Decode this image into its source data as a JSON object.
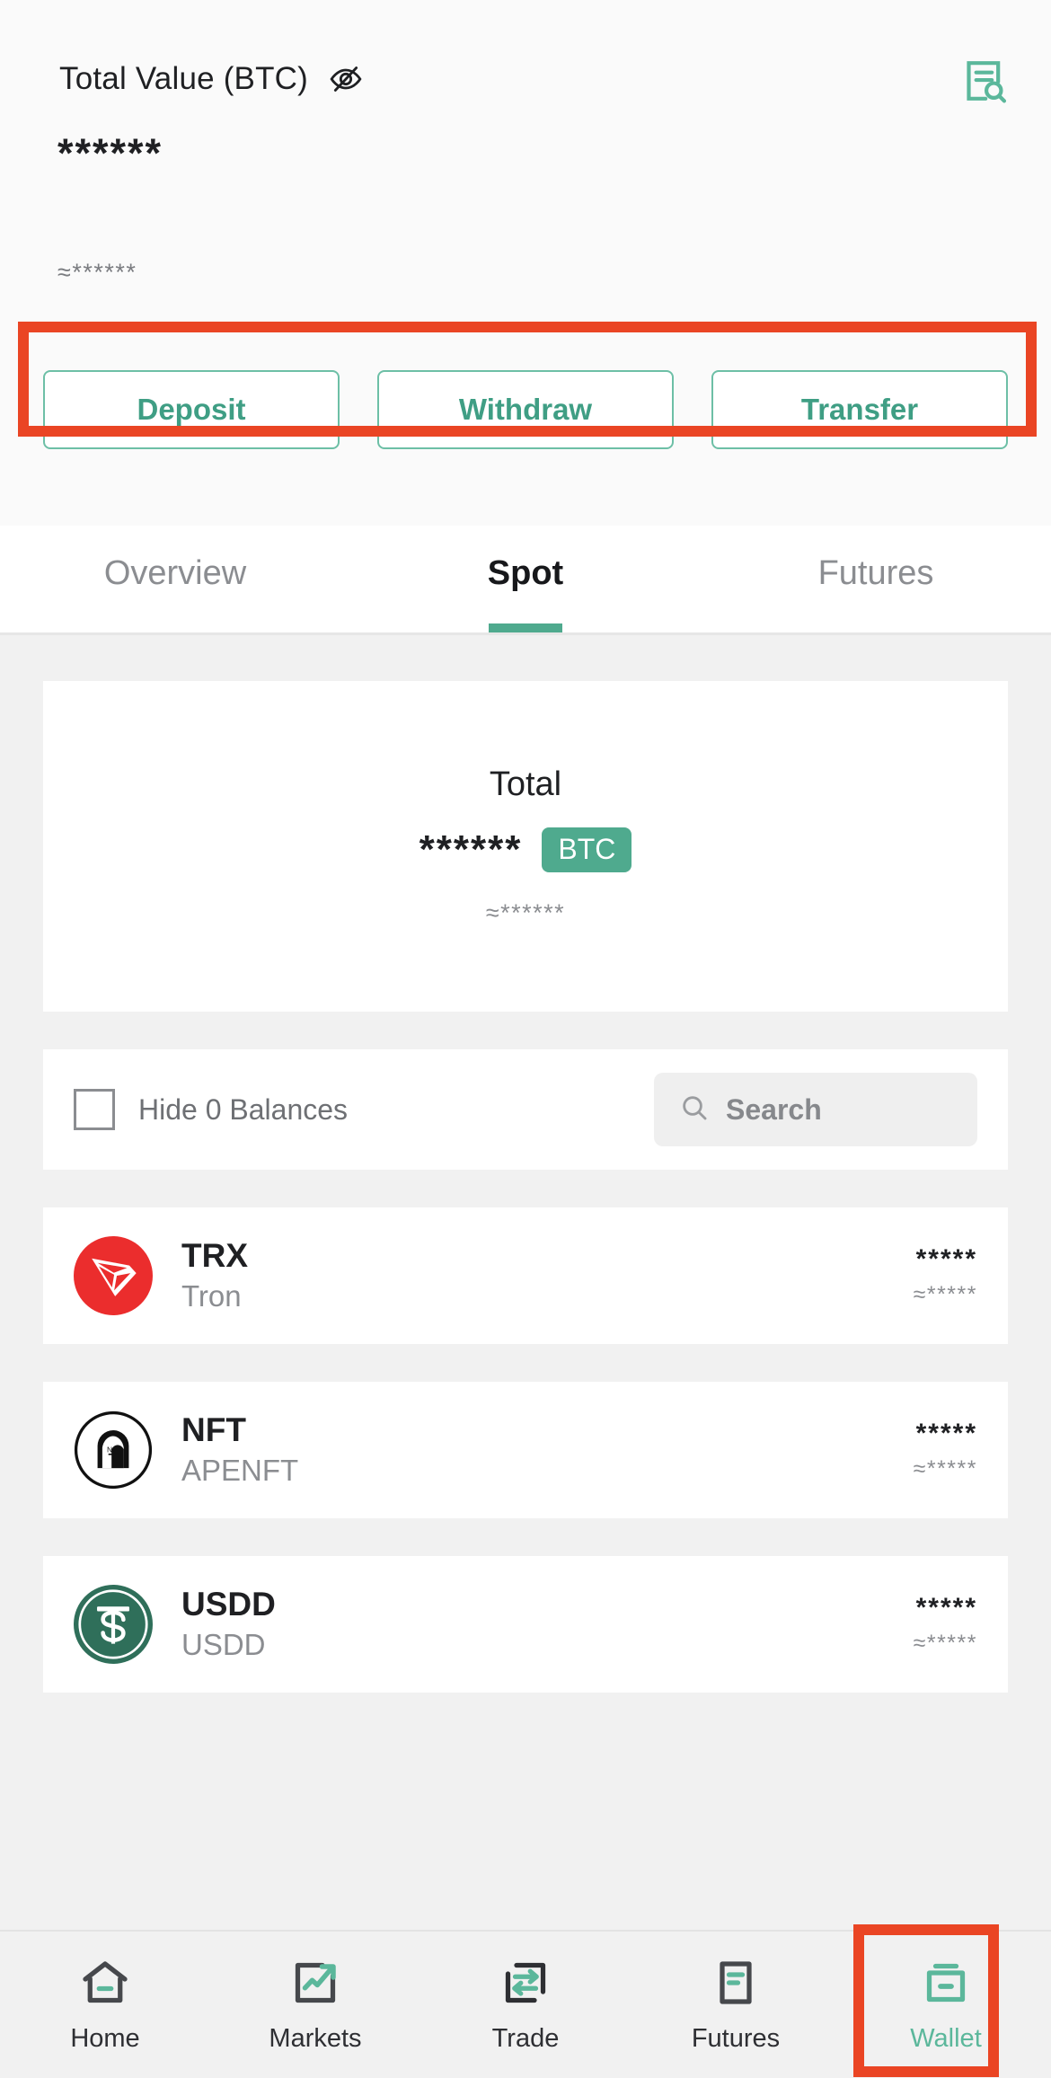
{
  "header": {
    "total_value_label": "Total Value (BTC)",
    "visibility_icon": "eye-off-icon",
    "history_icon": "document-search-icon",
    "masked_balance": "******",
    "masked_fiat": "≈******"
  },
  "actions": {
    "deposit_label": "Deposit",
    "withdraw_label": "Withdraw",
    "transfer_label": "Transfer"
  },
  "tabs": [
    {
      "label": "Overview",
      "active": false
    },
    {
      "label": "Spot",
      "active": true
    },
    {
      "label": "Futures",
      "active": false
    }
  ],
  "total_card": {
    "title": "Total",
    "masked_amount": "******",
    "currency_badge": "BTC",
    "masked_fiat": "≈******"
  },
  "filter": {
    "hide_zero_label": "Hide 0 Balances",
    "hide_zero_checked": false,
    "search_placeholder": "Search",
    "search_value": "",
    "search_icon": "search-icon"
  },
  "assets": [
    {
      "symbol": "TRX",
      "name": "Tron",
      "amount": "*****",
      "fiat": "≈*****",
      "logo": "tron-logo",
      "logo_color": "#eb2d2d"
    },
    {
      "symbol": "NFT",
      "name": "APENFT",
      "amount": "*****",
      "fiat": "≈*****",
      "logo": "apenft-logo",
      "logo_color": "#111111"
    },
    {
      "symbol": "USDD",
      "name": "USDD",
      "amount": "*****",
      "fiat": "≈*****",
      "logo": "usdd-logo",
      "logo_color": "#2f6f5a"
    }
  ],
  "bottom_nav": [
    {
      "label": "Home",
      "icon": "home-icon",
      "active": false
    },
    {
      "label": "Markets",
      "icon": "chart-up-icon",
      "active": false
    },
    {
      "label": "Trade",
      "icon": "swap-arrows-icon",
      "active": false
    },
    {
      "label": "Futures",
      "icon": "document-lines-icon",
      "active": false
    },
    {
      "label": "Wallet",
      "icon": "wallet-icon",
      "active": true
    }
  ],
  "colors": {
    "accent_teal": "#4faa8e",
    "annotation_red": "#ea4524",
    "page_bg": "#f1f1f1"
  }
}
